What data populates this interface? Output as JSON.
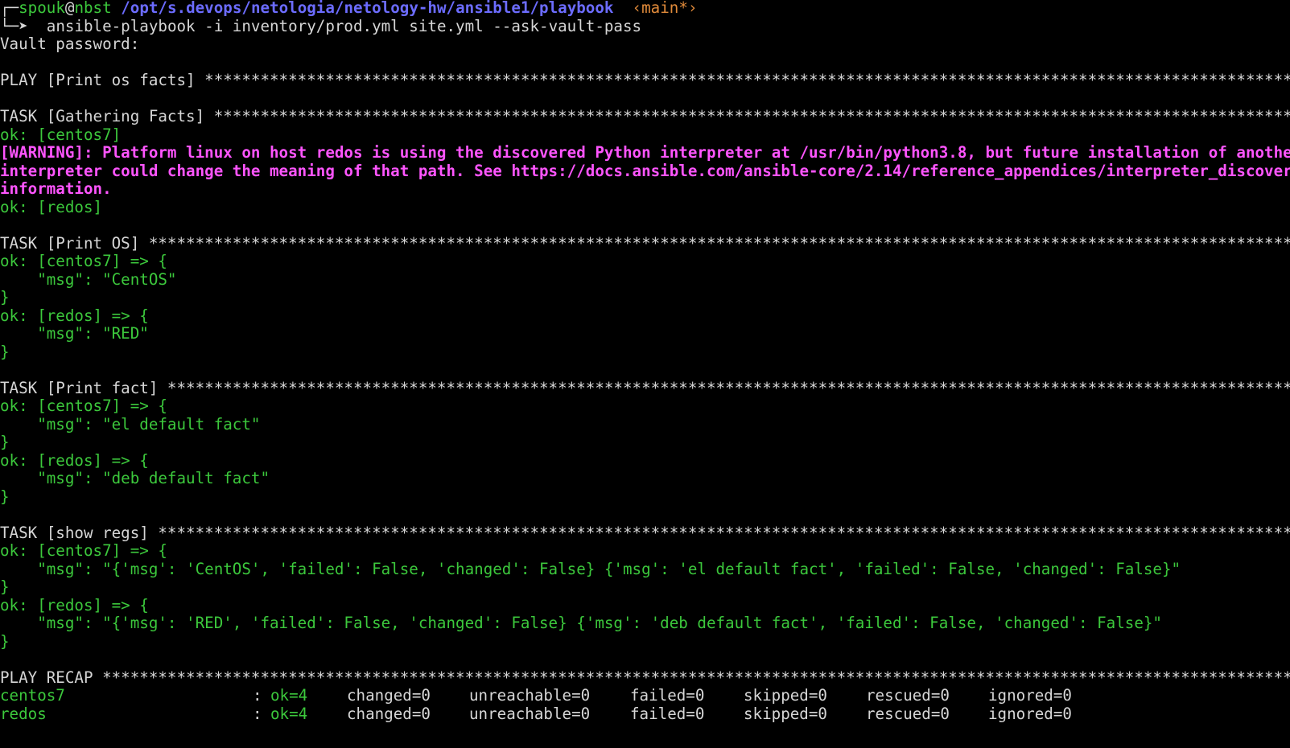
{
  "prompt": {
    "corner": "┌─",
    "user": "spouk",
    "at": "@",
    "host": "nbst",
    "path": "/opt/s.devops/netologia/netology-hw/ansible1/playbook",
    "branch": "‹main*›",
    "arrow": "└─➤",
    "command": "ansible-playbook -i inventory/prod.yml site.yml --ask-vault-pass"
  },
  "vault_prompt": "Vault password:",
  "lines": {
    "play_header": "PLAY [Print os facts] ***********************************************************************************************************************************************",
    "task_gather": "TASK [Gathering Facts] **********************************************************************************************************************************************",
    "ok_centos_gather": "ok: [centos7]",
    "warning_1": "[WARNING]: Platform linux on host redos is using the discovered Python interpreter at /usr/bin/python3.8, but future installation of another Python",
    "warning_2": "interpreter could change the meaning of that path. See https://docs.ansible.com/ansible-core/2.14/reference_appendices/interpreter_discovery.html for more",
    "warning_3": "information.",
    "ok_redos_gather": "ok: [redos]",
    "task_print_os": "TASK [Print OS] *****************************************************************************************************************************************************",
    "os_centos_open": "ok: [centos7] => {",
    "os_centos_msg": "    \"msg\": \"CentOS\"",
    "os_centos_close": "}",
    "os_redos_open": "ok: [redos] => {",
    "os_redos_msg": "    \"msg\": \"RED\"",
    "os_redos_close": "}",
    "task_print_fact": "TASK [Print fact] ***************************************************************************************************************************************************",
    "fact_centos_open": "ok: [centos7] => {",
    "fact_centos_msg": "    \"msg\": \"el default fact\"",
    "fact_centos_close": "}",
    "fact_redos_open": "ok: [redos] => {",
    "fact_redos_msg": "    \"msg\": \"deb default fact\"",
    "fact_redos_close": "}",
    "task_show_regs": "TASK [show regs] ****************************************************************************************************************************************************",
    "regs_centos_open": "ok: [centos7] => {",
    "regs_centos_msg": "    \"msg\": \"{'msg': 'CentOS', 'failed': False, 'changed': False} {'msg': 'el default fact', 'failed': False, 'changed': False}\"",
    "regs_centos_close": "}",
    "regs_redos_open": "ok: [redos] => {",
    "regs_redos_msg": "    \"msg\": \"{'msg': 'RED', 'failed': False, 'changed': False} {'msg': 'deb default fact', 'failed': False, 'changed': False}\"",
    "regs_redos_close": "}",
    "play_recap": "PLAY RECAP **********************************************************************************************************************************************************"
  },
  "recap": [
    {
      "host": "centos7",
      "colon": ":",
      "ok": "ok=4",
      "changed": "changed=0",
      "unreachable": "unreachable=0",
      "failed": "failed=0",
      "skipped": "skipped=0",
      "rescued": "rescued=0",
      "ignored": "ignored=0"
    },
    {
      "host": "redos",
      "colon": ":",
      "ok": "ok=4",
      "changed": "changed=0",
      "unreachable": "unreachable=0",
      "failed": "failed=0",
      "skipped": "skipped=0",
      "rescued": "rescued=0",
      "ignored": "ignored=0"
    }
  ],
  "colors": {
    "background": "#000000",
    "text": "#d6d6d6",
    "ok_green": "#3cc83c",
    "warning_magenta": "#ff55ff",
    "path_blue": "#6c6cff",
    "branch_orange": "#e08a3a"
  }
}
